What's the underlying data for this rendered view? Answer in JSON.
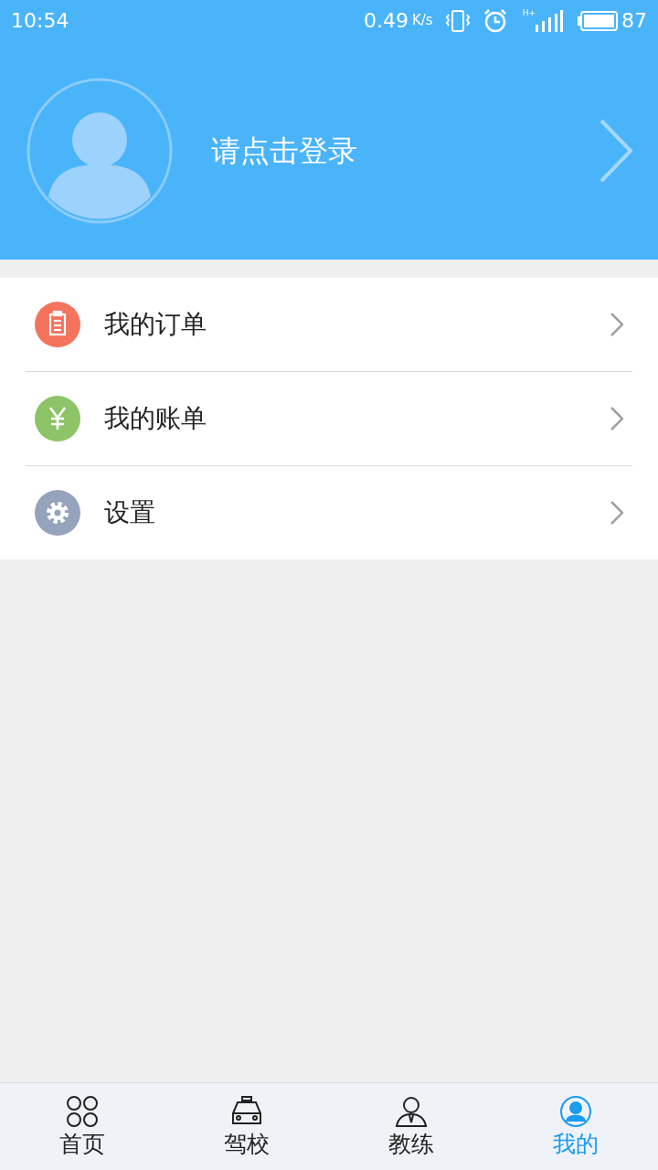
{
  "status_bar": {
    "time": "10:54",
    "speed": "0.49",
    "speed_unit": "K/s",
    "network": "H+",
    "battery": "87"
  },
  "header": {
    "login_prompt": "请点击登录"
  },
  "menu": [
    {
      "label": "我的订单",
      "kind": "orders",
      "color": "#f4735d"
    },
    {
      "label": "我的账单",
      "kind": "bills",
      "color": "#8cc467"
    },
    {
      "label": "设置",
      "kind": "settings",
      "color": "#95a3bd"
    }
  ],
  "tab_bar": [
    {
      "label": "首页",
      "kind": "home",
      "selected": false
    },
    {
      "label": "驾校",
      "kind": "school",
      "selected": false
    },
    {
      "label": "教练",
      "kind": "coach",
      "selected": false
    },
    {
      "label": "我的",
      "kind": "me",
      "selected": true
    }
  ]
}
